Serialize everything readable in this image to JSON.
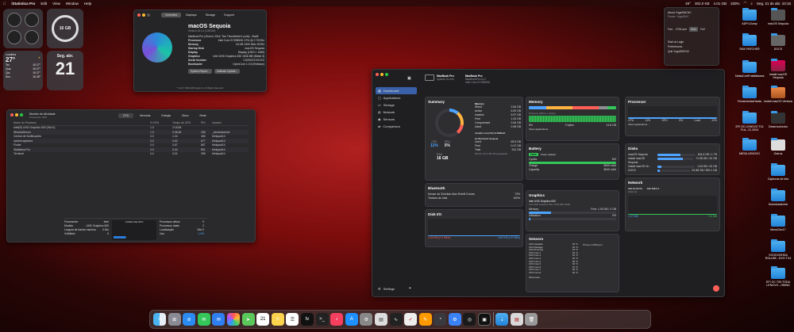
{
  "menubar": {
    "app": "iStatistica Pro",
    "items": [
      "Edit",
      "View",
      "Window",
      "Help"
    ],
    "status": [
      "49°",
      "302,0 KB",
      "4.01 GB",
      "100%"
    ],
    "datetime": "Seg. 21 de abr. 10:16"
  },
  "widgets": {
    "memory": "16 GB",
    "weather": {
      "city": "Londrina",
      "temp": "27°",
      "high": "27°",
      "low": "15°",
      "forecast": [
        {
          "day": "Ter.",
          "t": "15 27°"
        },
        {
          "day": "Qua.",
          "t": "15 27°"
        },
        {
          "day": "Qui.",
          "t": "15 27°"
        },
        {
          "day": "Sex.",
          "t": "16 28°"
        }
      ]
    },
    "calendar": {
      "weekday": "Seg. abr.",
      "day": "21"
    }
  },
  "about": {
    "tabs": [
      "Overview",
      "Displays",
      "Storage",
      "Support"
    ],
    "title": "macOS Sequoia",
    "version": "Version 15.4.1 (24E263)",
    "specs": [
      {
        "k": "MacBook Pro (15-inch, 2016, Two Thunderbolt 4 ports) - MacB",
        "v": ""
      },
      {
        "k": "Processor",
        "v": "Intel Core i9 9980HK CPU @ 2.70GHz"
      },
      {
        "k": "Memory",
        "v": "16 GB 2400 MHz DDR4"
      },
      {
        "k": "Startup Disk",
        "v": "macOS Sequoia"
      },
      {
        "k": "Display",
        "v": "Display (1920 × 1080)"
      },
      {
        "k": "Graphics",
        "v": "Intel UHD Graphics 630 1536 MB (Metal 3)"
      },
      {
        "k": "Serial Number",
        "v": "C02SXXXXXXXX"
      },
      {
        "k": "Bootloader",
        "v": "OpenCore 1.0.5 (Release)"
      }
    ],
    "buttons": [
      "System Report...",
      "Software Update..."
    ],
    "footer": "™ and © 1983-2025 Apple Inc. All Rights Reserved."
  },
  "activity": {
    "title": "Monitor de Atividade",
    "subtitle": "Processos: GPU",
    "tabs": [
      "CPU",
      "Memória",
      "Energia",
      "Disco",
      "Rede"
    ],
    "columns": [
      "Nome do Processo",
      "% GPU",
      "Tempo de GPU",
      "PID",
      "Usuário"
    ],
    "rows": [
      {
        "name": "Intel(R) UHD Graphics 630 (Slot 0)",
        "gpu": "1,0",
        "time": "2:18,98",
        "pid": "",
        "user": ""
      },
      {
        "name": "WindowServer",
        "gpu": "1,0",
        "time": "3:36,36",
        "pid": "156",
        "user": "_windowserver"
      },
      {
        "name": "Central de Notificações",
        "gpu": "0,0",
        "time": "1,34",
        "pid": "465",
        "user": "thinkpad14"
      },
      {
        "name": "screencaptureui",
        "gpu": "0,0",
        "time": "0,62",
        "pid": "677",
        "user": "thinkpad14"
      },
      {
        "name": "Finder",
        "gpu": "0,0",
        "time": "0,67",
        "pid": "867",
        "user": "thinkpad14"
      },
      {
        "name": "iStatistica Pro",
        "gpu": "0,0",
        "time": "0,04",
        "pid": "851",
        "user": "thinkpad14"
      },
      {
        "name": "Terminal",
        "gpu": "0,0",
        "time": "0,01",
        "pid": "398",
        "user": "thinkpad14"
      }
    ],
    "footer": [
      {
        "k": "Fornecedor",
        "v": "Intel"
      },
      {
        "k": "Modelo",
        "v": "UHD Graphics 630"
      },
      {
        "k": "Largura de banda máxima",
        "v": "0 B/s"
      },
      {
        "k": "VolMetric",
        "v": "0"
      }
    ],
    "footer2": [
      {
        "k": "Processos ativos",
        "v": "0"
      },
      {
        "k": "Processos totais",
        "v": "2"
      },
      {
        "k": "Localização",
        "v": "Slot 0"
      },
      {
        "k": "Uso",
        "v": "1,0%"
      }
    ],
    "graph_label": "CARGA DE GPU"
  },
  "istat": {
    "device": "MacBook Pro",
    "uptime": "Uptime 31 min",
    "model": "MacBookPro14,2",
    "cpu": "Intel Core i9 9980HK",
    "sidebar": [
      "Dashboard",
      "Applications",
      "Storage",
      "Network",
      "Sensors",
      "Comparison"
    ],
    "settings": "Settings",
    "summary": {
      "title": "Summary",
      "cpu_label": "CPU",
      "cpu": "11%",
      "gpu_label": "GPU",
      "gpu": "0%",
      "ram_label": "RAM",
      "ram": "16 GB",
      "memory": [
        {
          "k": "Wired",
          "v": "2.84 GB"
        },
        {
          "k": "Active",
          "v": "6.09 GB"
        },
        {
          "k": "Inactive",
          "v": "5.97 GB"
        },
        {
          "k": "Free",
          "v": "1.03 GB"
        },
        {
          "k": "Compressed",
          "v": "2.84 GB"
        },
        {
          "k": "Used",
          "v": "0.98 GB"
        }
      ],
      "gpu_model": "Intel(R) Core(TM) i9-9980HK",
      "disk": "Hi Macintosh Sequoia",
      "disk_vals": [
        {
          "k": "Used",
          "v": "69.5 GB"
        },
        {
          "k": "Free",
          "v": "0.47 GB"
        },
        {
          "k": "Total",
          "v": "512 GB"
        }
      ],
      "disk_note": "DOCS CS (1.89 TB purgeable)"
    },
    "memory": {
      "title": "Memory",
      "label": "Pressure (Wired + Swap)",
      "link": "Show applications...",
      "vals": [
        "5%",
        "0 bytes",
        "14.8 GB"
      ]
    },
    "processor": {
      "title": "Processor",
      "stats": [
        {
          "k": "CPU",
          "v": "11%"
        },
        {
          "k": "GPU",
          "v": "0%"
        },
        {
          "k": "Load",
          "v": "12%"
        }
      ],
      "link": "Show applications..."
    },
    "disks": {
      "title": "Disks",
      "items": [
        {
          "name": "macOS Sequoia",
          "v": "634.5 GB / 1 TB"
        },
        {
          "name": "Install macOS Sequoia",
          "v": "71.98 GB / 20 GB"
        },
        {
          "name": "Install macOS Ve...",
          "v": "1.63 GB / 20 GB"
        },
        {
          "name": "DOCS",
          "v": "81.88 GB / 990.1 GB"
        }
      ]
    },
    "battery": {
      "title": "Battery",
      "pct": "100%",
      "source": "Power adapter",
      "rows": [
        {
          "k": "Cycles",
          "v": "100"
        },
        {
          "k": "Charge",
          "v": "8640 mAh"
        },
        {
          "k": "Capacity",
          "v": "8640 mAh"
        }
      ]
    },
    "bluetooth": {
      "title": "Bluetooth",
      "devices": [
        {
          "name": "Mouse da Christian Alan Rotelli Gomes",
          "v": "73%"
        },
        {
          "name": "Teclado da Julia",
          "v": "100%"
        }
      ]
    },
    "graphics": {
      "title": "Graphics",
      "model": "Intel UHD Graphics 630",
      "sub": "Intel UHD Graphics 630 • 1536 MB VRAM",
      "rows": [
        {
          "k": "Memory",
          "v": "Free: 1.53 GB / 2 GB"
        },
        {
          "k": "Utilization",
          "v": "0%"
        }
      ]
    },
    "network": {
      "title": "Network",
      "ip": "192.12.20.56",
      "mac": "Ethernet",
      "public": "192.168.0.1",
      "down": "1.27 MB",
      "up": "2.6 MB"
    },
    "diskio": {
      "title": "Disk I/O",
      "read": "2,30 KB (2.3 KB/s)",
      "write": "4,60 KB (4.6 KB/s)"
    },
    "sensors": {
      "title": "Sensors",
      "items": [
        {
          "k": "CPU Heatsink",
          "v": "62 °C"
        },
        {
          "k": "CPU Package",
          "v": "62 °C"
        },
        {
          "k": "CPU Proximity",
          "v": "61 °C"
        },
        {
          "k": "CPU Core 1",
          "v": "62 °C"
        },
        {
          "k": "CPU Core 2",
          "v": "61 °C"
        },
        {
          "k": "CPU Core 3",
          "v": "62 °C"
        },
        {
          "k": "CPU Core 4",
          "v": "60 °C"
        },
        {
          "k": "CPU Core 5",
          "v": "62 °C"
        },
        {
          "k": "CPU Core 6",
          "v": "61 °C"
        },
        {
          "k": "CPU Core 7",
          "v": "62 °C"
        },
        {
          "k": "CPU Core 8",
          "v": "62 °C"
        }
      ],
      "fan": "Fan 1",
      "rpm": "2754 rpm",
      "link": "Show less..."
    }
  },
  "menu": {
    "title": "About YogaSMCNC",
    "items": [
      "Power: YogaSMC",
      "",
      ""
    ],
    "fan_label": "Fan:",
    "fan": "2754 rpm",
    "modes": [
      "Auto",
      "Full"
    ],
    "links": [
      "Start at Login",
      "Preferences",
      "Quit YogaSMCNC"
    ]
  },
  "desktop": [
    {
      "label": "ADPI-Dump"
    },
    {
      "label": "macOS Sequoia"
    },
    {
      "label": "SMX PATCHER"
    },
    {
      "label": "DOCS"
    },
    {
      "label": "NestaCortFrattellasses"
    },
    {
      "label": "Install macOS Sequoia"
    },
    {
      "label": "FerramentasHacks"
    },
    {
      "label": "Install macOS Ventura"
    },
    {
      "label": "EFI OC LENOVO T14 FLA...21 2024"
    },
    {
      "label": "Desenvolvedor"
    },
    {
      "label": "MESA LENOVO"
    },
    {
      "label": "Outros"
    },
    {
      "label": "Capturas de tela"
    },
    {
      "label": "DownloadsLink"
    },
    {
      "label": "MenuDev17"
    },
    {
      "label": "VOODOOHDA ROLLBE...DVO TX4"
    },
    {
      "label": "EFI OC T05 TODA LENOVO...OBIND"
    }
  ],
  "dock": [
    "Finder",
    "Launchpad",
    "Safari",
    "Messages",
    "Mail",
    "Photos",
    "Maps",
    "Calendar",
    "Notes",
    "Reminders",
    "TV",
    "Terminal",
    "Music",
    "App Store",
    "System Settings",
    "Preview",
    "Activity Monitor",
    "Activity Monitor",
    "Pages",
    "iStatistica",
    "Downloads",
    "Docs",
    "Trash"
  ]
}
